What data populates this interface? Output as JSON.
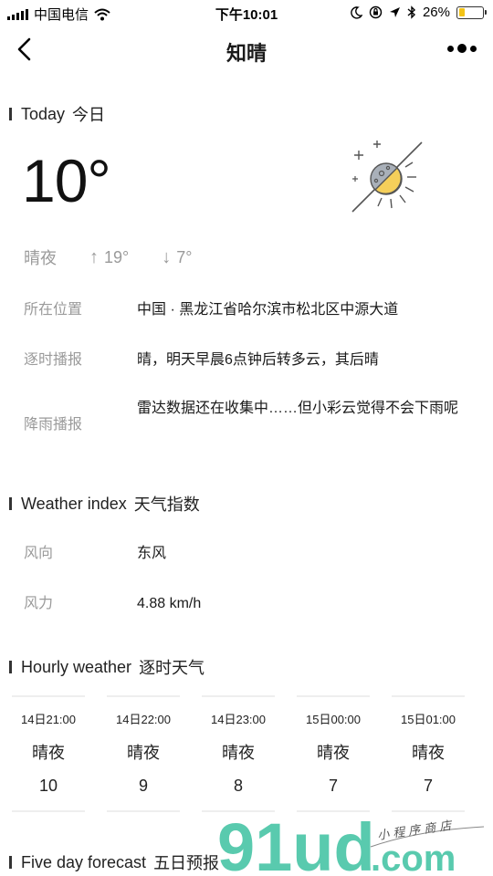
{
  "status_bar": {
    "carrier": "中国电信",
    "time": "下午10:01",
    "battery_percent": "26%",
    "battery_level": 0.26,
    "icons": [
      "signal-icon",
      "wifi-icon",
      "moon-icon",
      "orientation-lock-icon",
      "location-icon",
      "bluetooth-icon",
      "battery-icon"
    ]
  },
  "nav": {
    "title": "知晴",
    "back_icon": "back-arrow-icon",
    "more_icon": "more-dots-icon"
  },
  "today": {
    "heading_en": "Today",
    "heading_cn": "今日",
    "temperature": "10°",
    "condition": "晴夜",
    "high": "19°",
    "low": "7°",
    "weather_icon": "clear-night-icon",
    "rows": [
      {
        "label": "所在位置",
        "value": "中国 · 黑龙江省哈尔滨市松北区中源大道"
      },
      {
        "label": "逐时播报",
        "value": "晴，明天早晨6点钟后转多云，其后晴"
      },
      {
        "label": "降雨播报",
        "value": "雷达数据还在收集中……但小彩云觉得不会下雨呢"
      }
    ]
  },
  "weather_index": {
    "heading_en": "Weather index",
    "heading_cn": "天气指数",
    "rows": [
      {
        "label": "风向",
        "value": "东风"
      },
      {
        "label": "风力",
        "value": "4.88 km/h"
      }
    ]
  },
  "hourly": {
    "heading_en": "Hourly weather",
    "heading_cn": "逐时天气",
    "items": [
      {
        "time": "14日21:00",
        "condition": "晴夜",
        "temp": "10"
      },
      {
        "time": "14日22:00",
        "condition": "晴夜",
        "temp": "9"
      },
      {
        "time": "14日23:00",
        "condition": "晴夜",
        "temp": "8"
      },
      {
        "time": "15日00:00",
        "condition": "晴夜",
        "temp": "7"
      },
      {
        "time": "15日01:00",
        "condition": "晴夜",
        "temp": "7"
      }
    ]
  },
  "five_day": {
    "heading_en": "Five day forecast",
    "heading_cn": "五日预报"
  },
  "watermark": {
    "text": "91ud.com",
    "tagline": "小程序商店"
  },
  "colors": {
    "accent_green": "#3cc1a0",
    "muted_text": "#9a9a9a",
    "battery_yellow": "#f3c316",
    "sun_yellow": "#f5cf5a"
  }
}
